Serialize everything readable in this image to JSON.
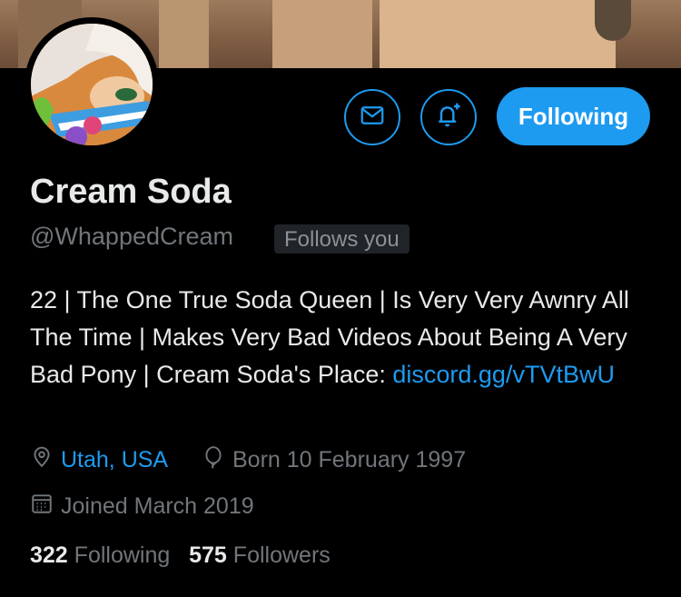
{
  "profile": {
    "name": "Cream Soda",
    "handle": "@WhappedCream",
    "follows_you": "Follows you",
    "bio_text": "22 | The One True Soda Queen | Is Very Very Awnry All The Time | Makes Very Bad Videos About Being A Very Bad Pony | Cream Soda's Place: ",
    "bio_link": "discord.gg/vTVtBwU",
    "location": "Utah, USA",
    "birthday": "Born 10 February 1997",
    "joined": "Joined March 2019",
    "following_count": "322",
    "following_label": "Following",
    "followers_count": "575",
    "followers_label": "Followers"
  },
  "actions": {
    "message_icon": "envelope-icon",
    "notify_icon": "bell-plus-icon",
    "follow_button_label": "Following"
  },
  "colors": {
    "accent": "#1d9bf0",
    "secondary_text": "#71767b",
    "background": "#000000"
  }
}
